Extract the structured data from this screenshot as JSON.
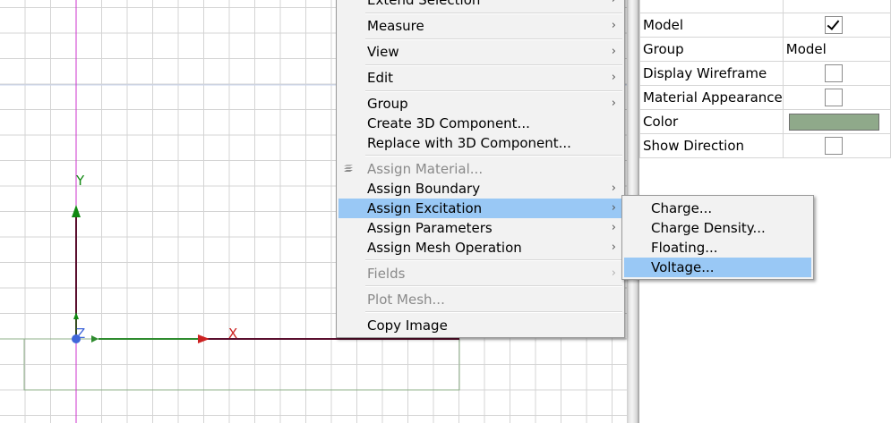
{
  "viewport": {
    "axes": {
      "x": "X",
      "y": "Y",
      "z": "Z"
    }
  },
  "properties": [
    {
      "name": "Model",
      "type": "checkbox",
      "checked": true
    },
    {
      "name": "Group",
      "type": "text",
      "value": "Model"
    },
    {
      "name": "Display Wireframe",
      "type": "checkbox",
      "checked": false
    },
    {
      "name": "Material Appearance",
      "type": "checkbox",
      "checked": false
    },
    {
      "name": "Color",
      "type": "color",
      "value": "#8fa98a"
    },
    {
      "name": "Show Direction",
      "type": "checkbox",
      "checked": false
    }
  ],
  "context_menu": {
    "extend_selection": "Extend Selection",
    "measure": "Measure",
    "view": "View",
    "edit": "Edit",
    "group": "Group",
    "create_3d_component": "Create 3D Component...",
    "replace_3d_component": "Replace with 3D Component...",
    "assign_material": "Assign Material...",
    "assign_boundary": "Assign Boundary",
    "assign_excitation": "Assign Excitation",
    "assign_parameters": "Assign Parameters",
    "assign_mesh_operation": "Assign Mesh Operation",
    "fields": "Fields",
    "plot_mesh": "Plot Mesh...",
    "copy_image": "Copy Image"
  },
  "submenu": {
    "charge": "Charge...",
    "charge_density": "Charge Density...",
    "floating": "Floating...",
    "voltage": "Voltage..."
  },
  "colors": {
    "menu_highlight": "#99c8f5",
    "grid": "#d4d4d4",
    "model_outline": "#8fb08a"
  }
}
